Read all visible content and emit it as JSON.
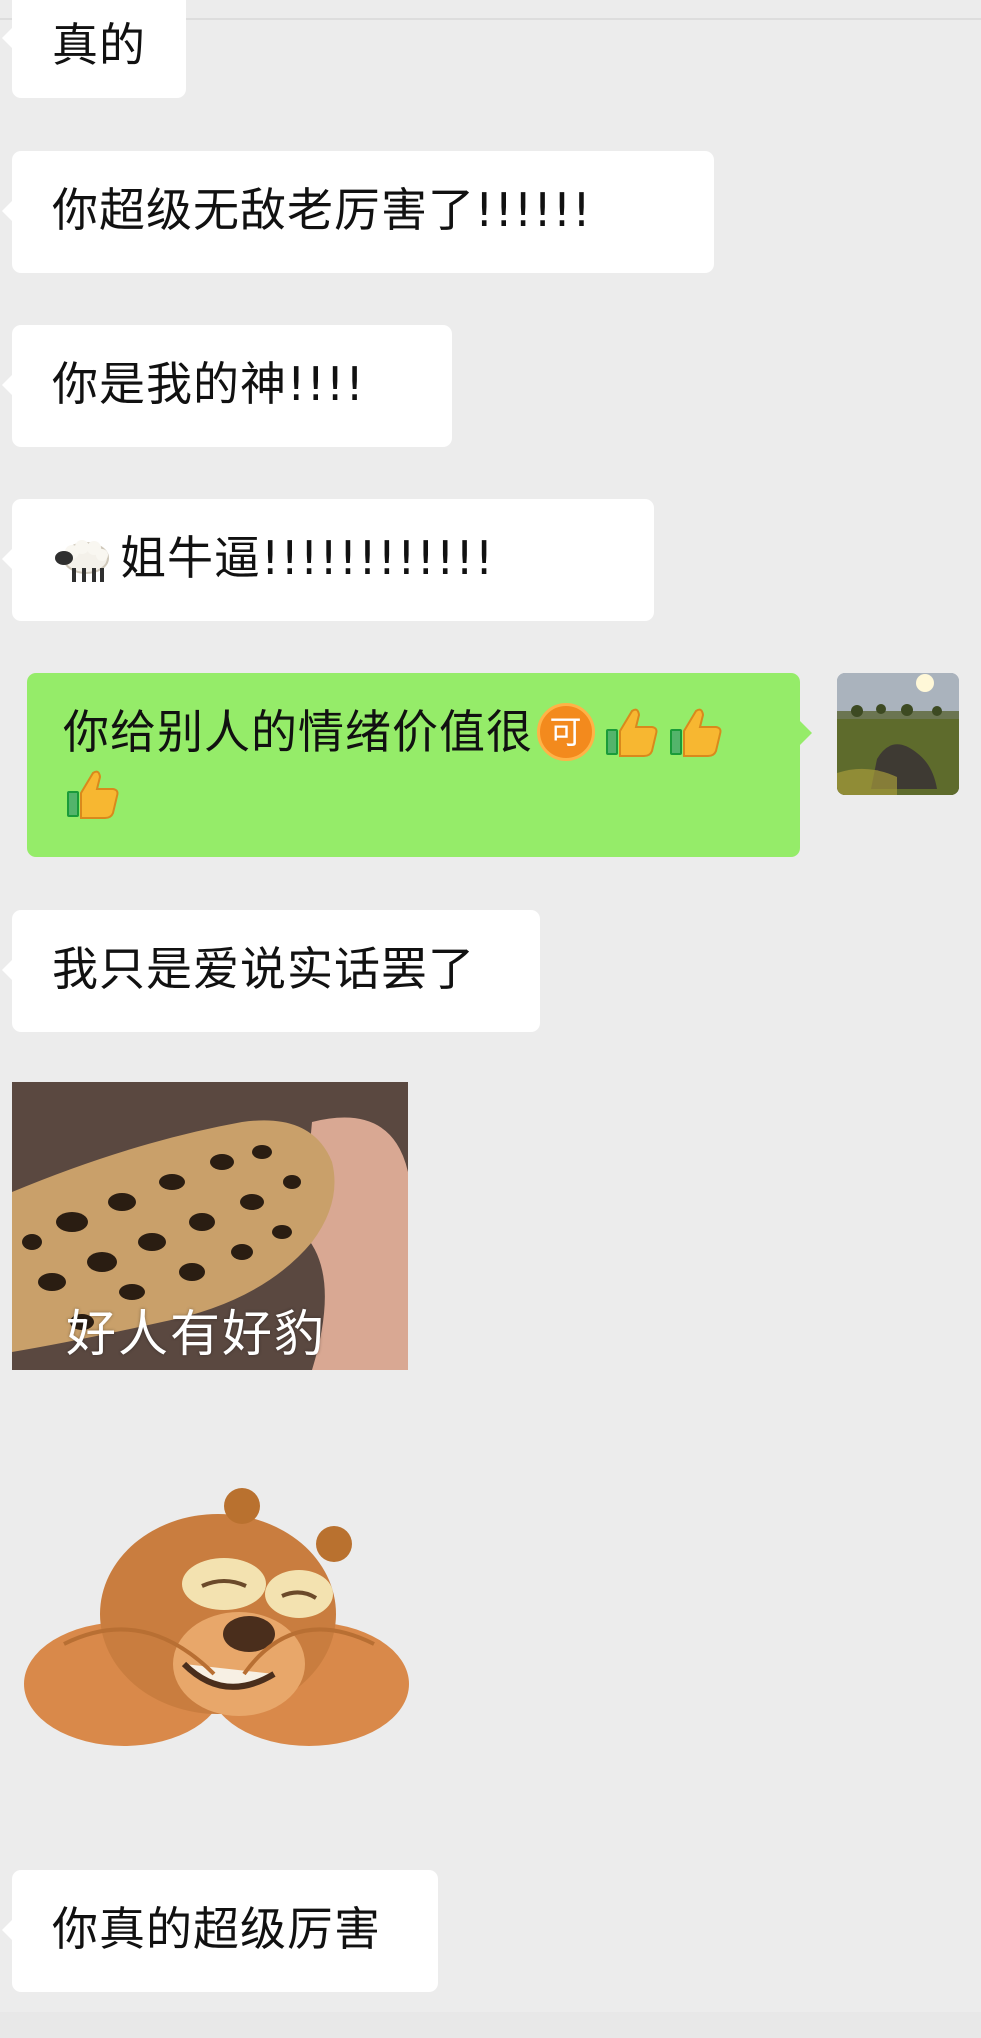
{
  "messages": [
    {
      "side": "left",
      "text": "真的"
    },
    {
      "side": "left",
      "text": "你超级无敌老厉害了!!!!!!"
    },
    {
      "side": "left",
      "text": "你是我的神!!!!"
    },
    {
      "side": "left",
      "text": "姐牛逼!!!!!!!!!!!!",
      "emoji": "sheep-emoji"
    },
    {
      "side": "right",
      "text": "你给别人的情绪价值很",
      "emoji_badge": "可",
      "emojis": [
        "thumbs-up-emoji",
        "thumbs-up-emoji",
        "thumbs-up-emoji"
      ]
    },
    {
      "side": "left",
      "text": "我只是爱说实话罢了"
    },
    {
      "side": "left",
      "type": "sticker",
      "sticker": "leopard-paw-handshake",
      "caption": "好人有好豹"
    },
    {
      "side": "left",
      "type": "sticker",
      "sticker": "bear-hug-sticker"
    },
    {
      "side": "left",
      "text": "你真的超级厉害"
    }
  ],
  "colors": {
    "background": "#ececec",
    "bubble_left": "#ffffff",
    "bubble_right": "#95ec69",
    "badge": "#f38a1d"
  }
}
